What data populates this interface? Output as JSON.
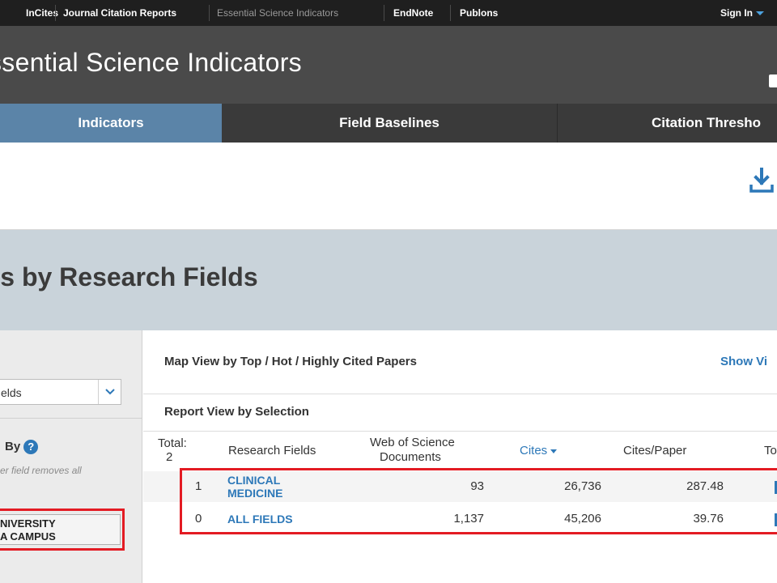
{
  "top_links": [
    "InCites",
    "Journal Citation Reports",
    "Essential Science Indicators",
    "EndNote",
    "Publons"
  ],
  "sign_in": "Sign In",
  "app_title": "ssential Science Indicators",
  "tabs": [
    "Indicators",
    "Field Baselines",
    "Citation Thresho"
  ],
  "page_title": "ers by Research Fields",
  "left_panel": {
    "field_select_value": "elds",
    "filter_label": "By",
    "filter_note": "er field removes all",
    "institution_lines": [
      "NIVERSITY",
      "A CAMPUS"
    ]
  },
  "main": {
    "map_view_label": "Map View by Top / Hot / Highly Cited Papers",
    "show_vis_link": "Show Vi",
    "report_view_label": "Report View by Selection",
    "table": {
      "headers": {
        "total_label": "Total:",
        "total_value": "2",
        "research_fields": "Research Fields",
        "wos_line1": "Web of Science",
        "wos_line2": "Documents",
        "cites": "Cites",
        "cites_per_paper": "Cites/Paper",
        "top": "To"
      },
      "rows": [
        {
          "index": "1",
          "field_line1": "CLINICAL",
          "field_line2": "MEDICINE",
          "documents": "93",
          "cites": "26,736",
          "cites_per_paper": "287.48"
        },
        {
          "index": "0",
          "field_line1": "ALL FIELDS",
          "field_line2": "",
          "documents": "1,137",
          "cites": "45,206",
          "cites_per_paper": "39.76"
        }
      ]
    }
  },
  "colors": {
    "top_bar": "#1f1f1f",
    "title_bar": "#4a4a4a",
    "active_tab": "#5b84a8",
    "link_blue": "#2d78b8",
    "highlight_red": "#e31b23"
  },
  "icons": {
    "download": "download-icon",
    "help": "help-icon",
    "chevron": "chevron-down-icon",
    "sort": "sort-desc-icon"
  }
}
